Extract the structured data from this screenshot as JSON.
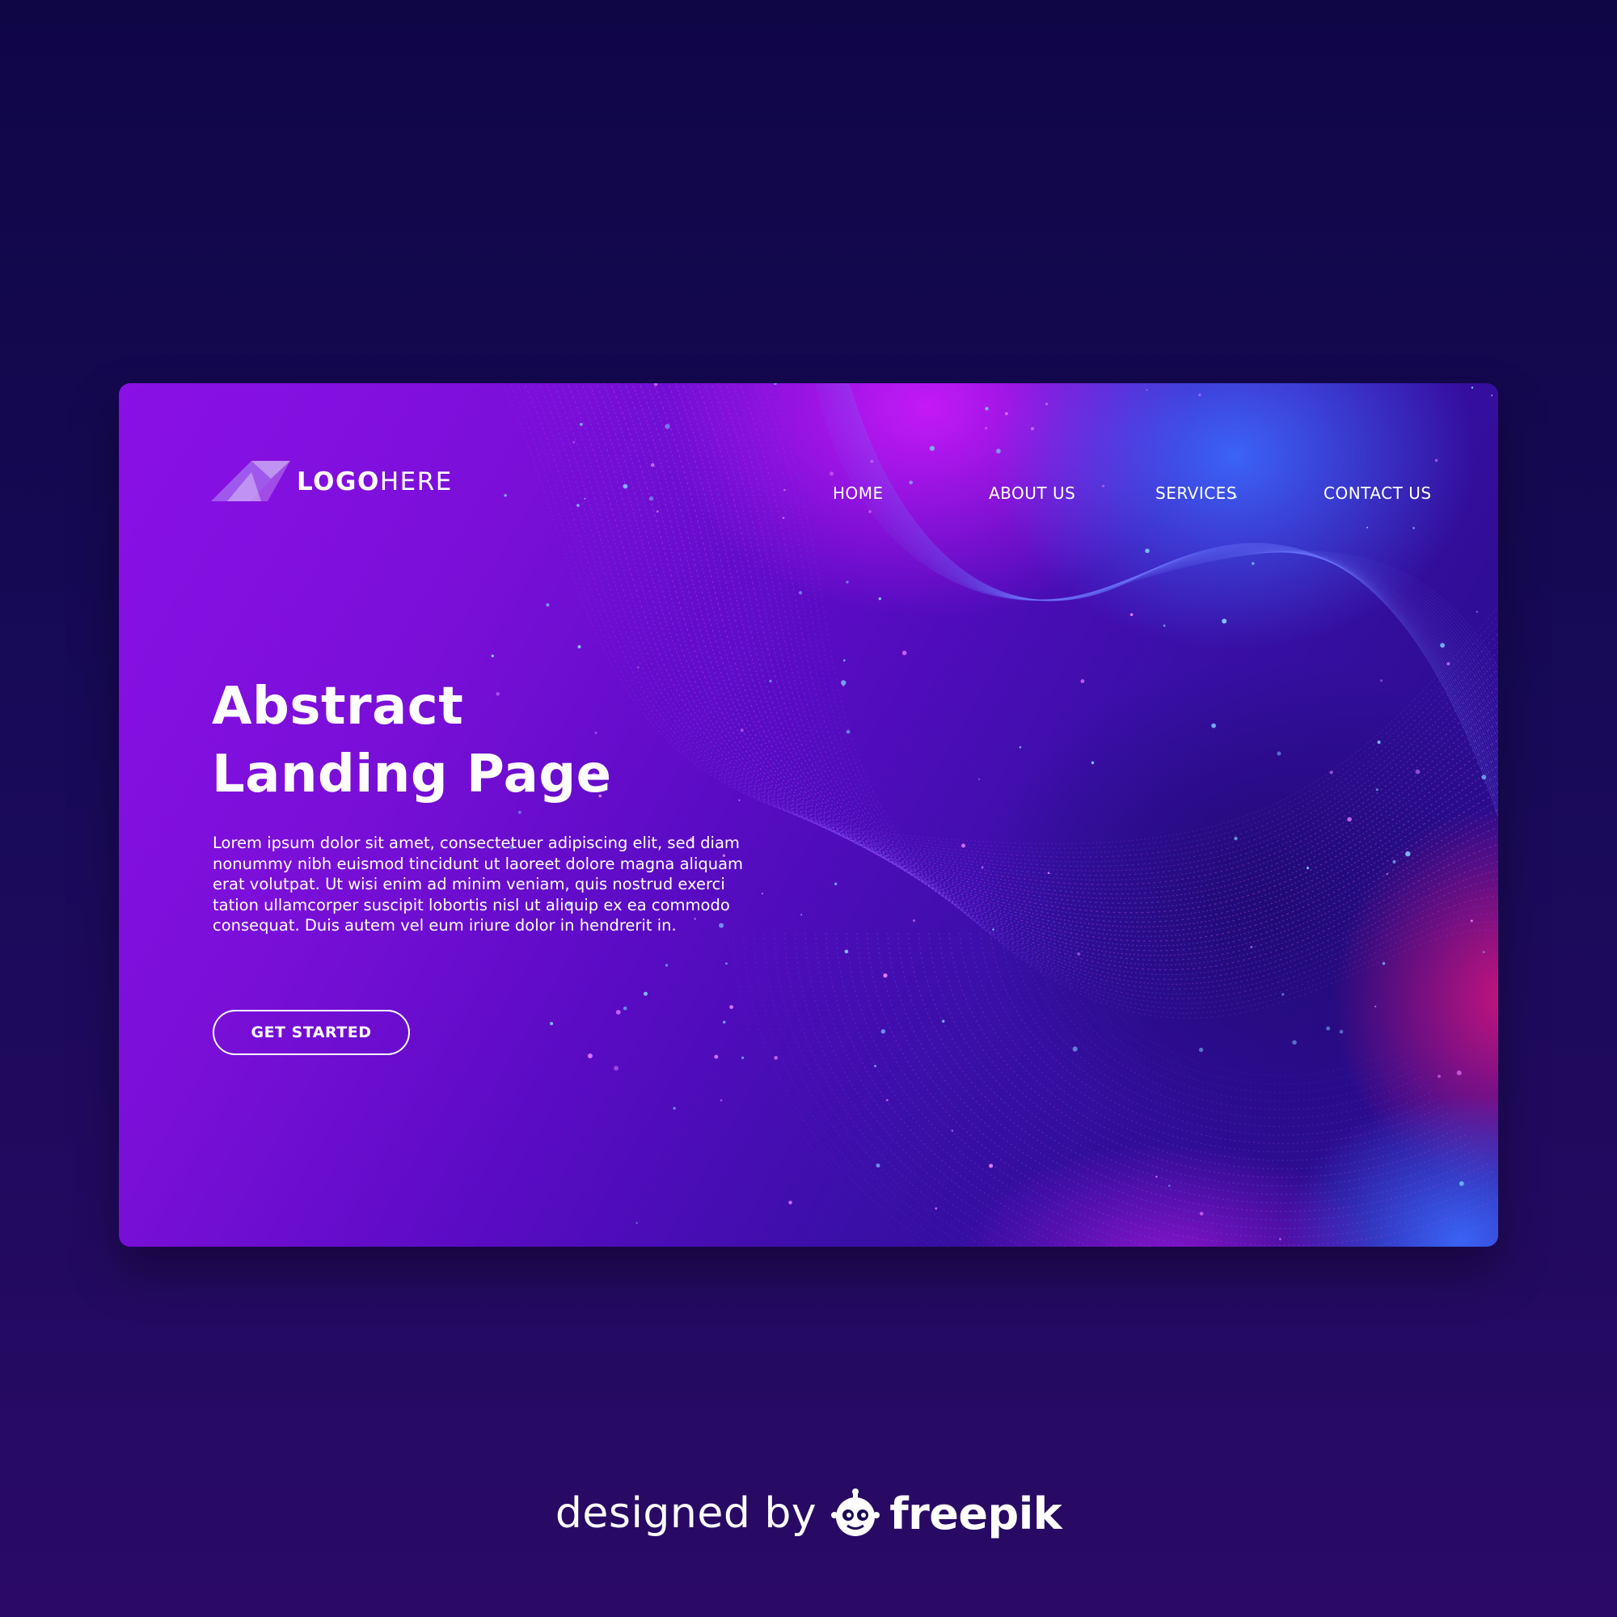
{
  "logo": {
    "text_bold": "LOGO",
    "text_light": "HERE"
  },
  "nav": {
    "items": [
      "HOME",
      "ABOUT US",
      "SERVICES",
      "CONTACT US"
    ]
  },
  "hero": {
    "title_line1": "Abstract",
    "title_line2": "Landing Page",
    "body": "Lorem ipsum dolor sit amet, consectetuer adipiscing elit, sed diam nonummy nibh euismod tincidunt ut laoreet dolore magna aliquam erat volutpat. Ut wisi enim ad minim veniam, quis nostrud exerci tation ullamcorper suscipit lobortis nisl ut aliquip ex ea commodo consequat. Duis autem vel eum iriure dolor in hendrerit in.",
    "cta_label": "GET STARTED"
  },
  "credit": {
    "prefix": "designed by",
    "brand": "freepik",
    "icon": "freepik-robot-icon"
  },
  "colors": {
    "page_bg_top": "#0f0646",
    "page_bg_bottom": "#2a0a66",
    "card_left": "#8a10e6",
    "card_right": "#2c0c8f",
    "accent_magenta": "#d31cff",
    "accent_blue": "#3a6cff",
    "text": "#ffffff"
  }
}
